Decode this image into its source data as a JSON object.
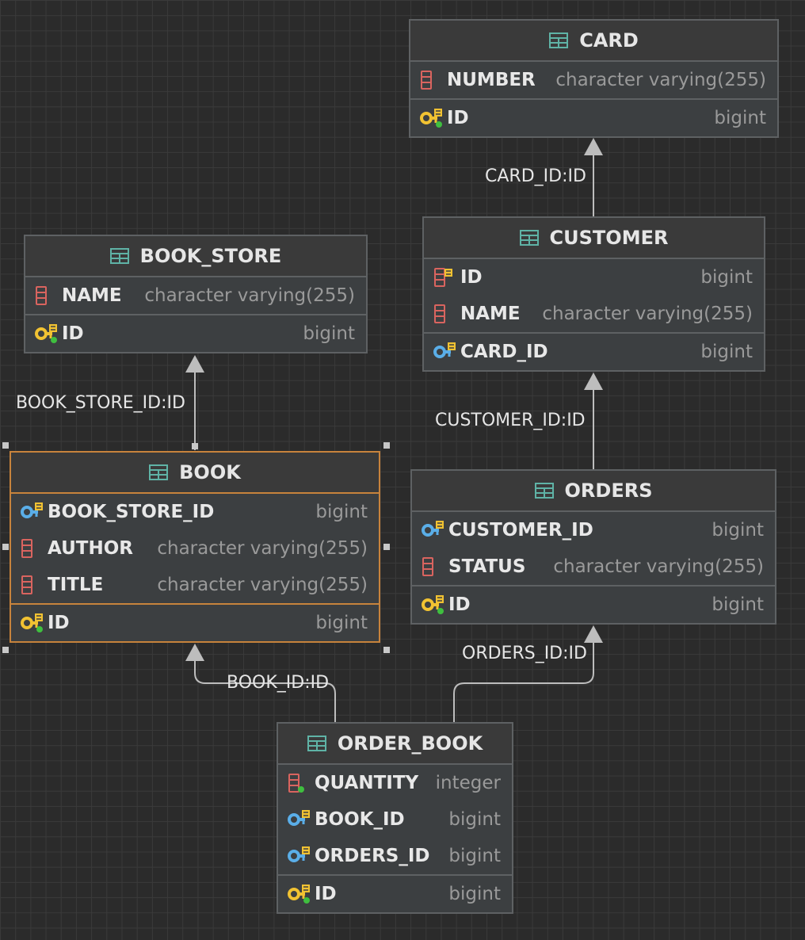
{
  "tables": {
    "card": {
      "name": "CARD",
      "columns": [
        {
          "name": "NUMBER",
          "type": "character varying(255)",
          "icon": "column-icon"
        }
      ],
      "keys": [
        {
          "name": "ID",
          "type": "bigint",
          "icon": "primary-key-icon"
        }
      ]
    },
    "customer": {
      "name": "CUSTOMER",
      "columns": [
        {
          "name": "ID",
          "type": "bigint",
          "icon": "column-key-icon"
        },
        {
          "name": "NAME",
          "type": "character varying(255)",
          "icon": "column-icon"
        }
      ],
      "keys": [
        {
          "name": "CARD_ID",
          "type": "bigint",
          "icon": "foreign-key-icon"
        }
      ]
    },
    "book_store": {
      "name": "BOOK_STORE",
      "columns": [
        {
          "name": "NAME",
          "type": "character varying(255)",
          "icon": "column-icon"
        }
      ],
      "keys": [
        {
          "name": "ID",
          "type": "bigint",
          "icon": "primary-key-icon"
        }
      ]
    },
    "book": {
      "name": "BOOK",
      "columns": [
        {
          "name": "BOOK_STORE_ID",
          "type": "bigint",
          "icon": "foreign-key-icon"
        },
        {
          "name": "AUTHOR",
          "type": "character varying(255)",
          "icon": "column-icon"
        },
        {
          "name": "TITLE",
          "type": "character varying(255)",
          "icon": "column-icon"
        }
      ],
      "keys": [
        {
          "name": "ID",
          "type": "bigint",
          "icon": "primary-key-icon"
        }
      ]
    },
    "orders": {
      "name": "ORDERS",
      "columns": [
        {
          "name": "CUSTOMER_ID",
          "type": "bigint",
          "icon": "foreign-key-icon"
        },
        {
          "name": "STATUS",
          "type": "character varying(255)",
          "icon": "column-icon"
        }
      ],
      "keys": [
        {
          "name": "ID",
          "type": "bigint",
          "icon": "primary-key-icon"
        }
      ]
    },
    "order_book": {
      "name": "ORDER_BOOK",
      "columns": [
        {
          "name": "QUANTITY",
          "type": "integer",
          "icon": "column-notnull-icon"
        },
        {
          "name": "BOOK_ID",
          "type": "bigint",
          "icon": "foreign-key-icon"
        },
        {
          "name": "ORDERS_ID",
          "type": "bigint",
          "icon": "foreign-key-icon"
        }
      ],
      "keys": [
        {
          "name": "ID",
          "type": "bigint",
          "icon": "primary-key-icon"
        }
      ]
    }
  },
  "relations": {
    "card_id": "CARD_ID:ID",
    "book_store_id": "BOOK_STORE_ID:ID",
    "customer_id": "CUSTOMER_ID:ID",
    "orders_id": "ORDERS_ID:ID",
    "book_id": "BOOK_ID:ID"
  },
  "colors": {
    "background": "#2b2b2b",
    "table_fill": "#3c3f41",
    "table_border": "#5e6163",
    "selected_border": "#c7833c",
    "table_icon": "#5fb3a6",
    "column_icon": "#d9645f",
    "primary_key": "#f1c232",
    "foreign_key": "#5aaee8",
    "type_text": "#9a9a9a"
  }
}
